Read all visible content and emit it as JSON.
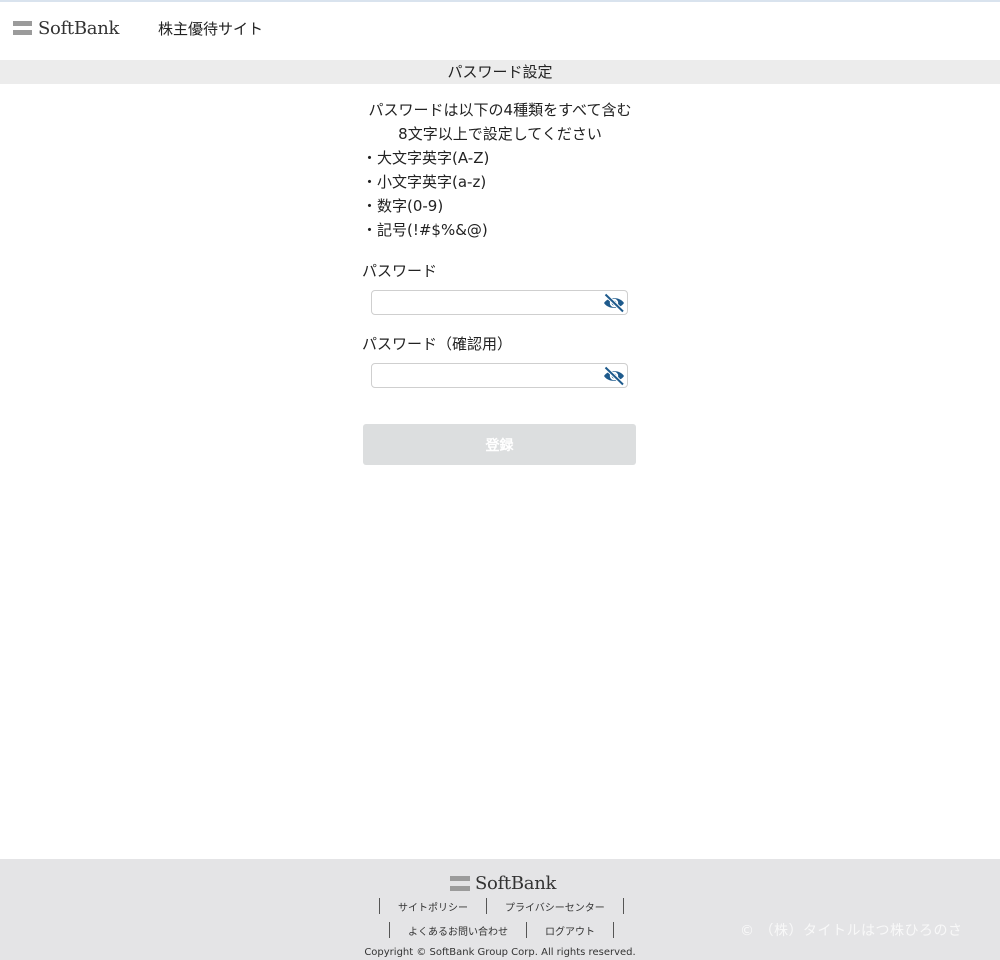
{
  "brand": {
    "name": "SoftBank"
  },
  "header": {
    "site_name": "株主優待サイト"
  },
  "page": {
    "title": "パスワード設定"
  },
  "instructions": {
    "line1": "パスワードは以下の4種類をすべて含む",
    "line2": "8文字以上で設定してください",
    "rules": [
      "・大文字英字(A-Z)",
      "・小文字英字(a-z)",
      "・数字(0-9)",
      "・記号(!#$%&@)"
    ]
  },
  "form": {
    "password_label": "パスワード",
    "password_value": "",
    "confirm_label": "パスワード（確認用）",
    "confirm_value": "",
    "submit_label": "登録",
    "toggle_icon": "eye-slash-icon",
    "icon_color": "#1e5a8c"
  },
  "footer": {
    "links_row1": [
      "サイトポリシー",
      "プライバシーセンター"
    ],
    "links_row2": [
      "よくあるお問い合わせ",
      "ログアウト"
    ],
    "copyright": "Copyright © SoftBank Group Corp. All rights reserved.",
    "watermark": "© （株）タイトルはつ株ひろのさ"
  }
}
